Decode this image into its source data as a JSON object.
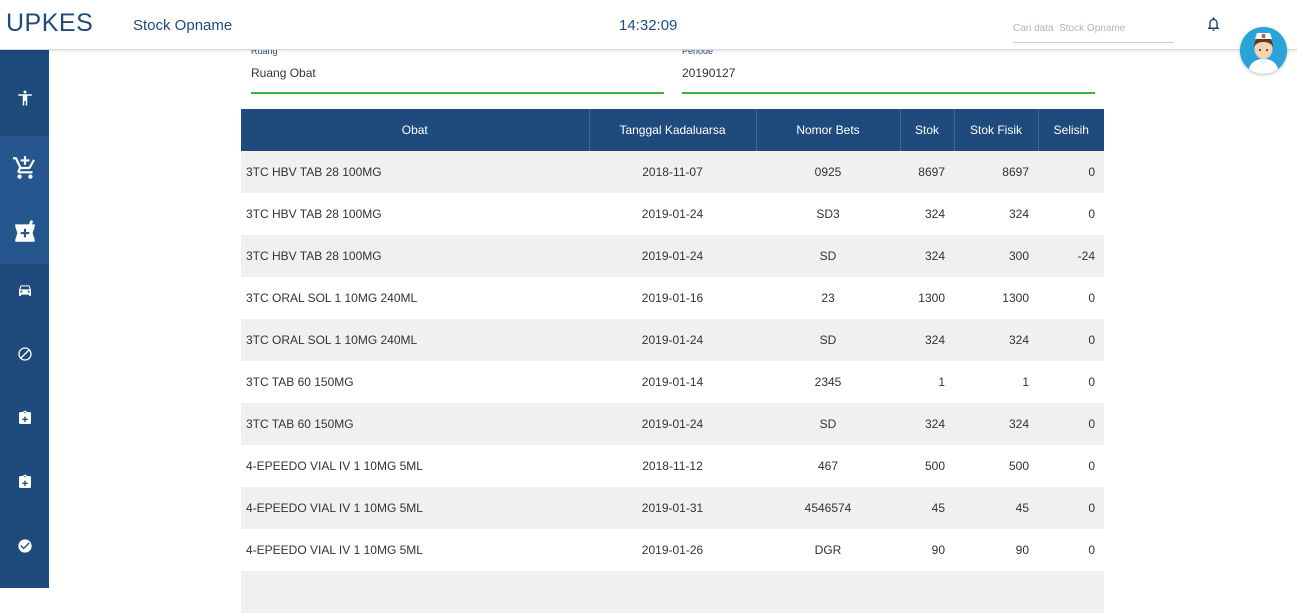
{
  "app": {
    "brand": "UPKES",
    "page_title": "Stock Opname",
    "clock": "14:32:09"
  },
  "search": {
    "placeholder": "Cari data  Stock Opname"
  },
  "icons": {
    "bell": "bell-icon",
    "avatar": "nurse-avatar"
  },
  "sidebar": {
    "items": [
      {
        "name": "accessibility-icon"
      },
      {
        "name": "add-shopping-cart-icon"
      },
      {
        "name": "local-pharmacy-icon"
      },
      {
        "name": "car-icon"
      },
      {
        "name": "block-icon"
      },
      {
        "name": "medical-box-icon"
      },
      {
        "name": "medical-box-icon"
      },
      {
        "name": "check-circle-icon"
      }
    ]
  },
  "form": {
    "ruang": {
      "label": "Ruang",
      "value": "Ruang Obat"
    },
    "periode": {
      "label": "Periode",
      "value": "20190127"
    }
  },
  "table": {
    "headers": [
      "Obat",
      "Tanggal Kadaluarsa",
      "Nomor Bets",
      "Stok",
      "Stok Fisik",
      "Selisih"
    ],
    "rows": [
      [
        "3TC HBV TAB 28 100MG",
        "2018-11-07",
        "0925",
        "8697",
        "8697",
        "0"
      ],
      [
        "3TC HBV TAB 28 100MG",
        "2019-01-24",
        "SD3",
        "324",
        "324",
        "0"
      ],
      [
        "3TC HBV TAB 28 100MG",
        "2019-01-24",
        "SD",
        "324",
        "300",
        "-24"
      ],
      [
        "3TC ORAL SOL 1 10MG 240ML",
        "2019-01-16",
        "23",
        "1300",
        "1300",
        "0"
      ],
      [
        "3TC ORAL SOL 1 10MG 240ML",
        "2019-01-24",
        "SD",
        "324",
        "324",
        "0"
      ],
      [
        "3TC TAB 60 150MG",
        "2019-01-14",
        "2345",
        "1",
        "1",
        "0"
      ],
      [
        "3TC TAB 60 150MG",
        "2019-01-24",
        "SD",
        "324",
        "324",
        "0"
      ],
      [
        "4-EPEEDO VIAL IV 1 10MG 5ML",
        "2018-11-12",
        "467",
        "500",
        "500",
        "0"
      ],
      [
        "4-EPEEDO VIAL IV 1 10MG 5ML",
        "2019-01-31",
        "4546574",
        "45",
        "45",
        "0"
      ],
      [
        "4-EPEEDO VIAL IV 1 10MG 5ML",
        "2019-01-26",
        "DGR",
        "90",
        "90",
        "0"
      ],
      [
        "",
        "",
        "",
        "",
        "",
        ""
      ]
    ]
  },
  "colors": {
    "primary": "#1f4a7c",
    "accent_line": "#3fae49",
    "row_alt": "#f0f0f0"
  }
}
